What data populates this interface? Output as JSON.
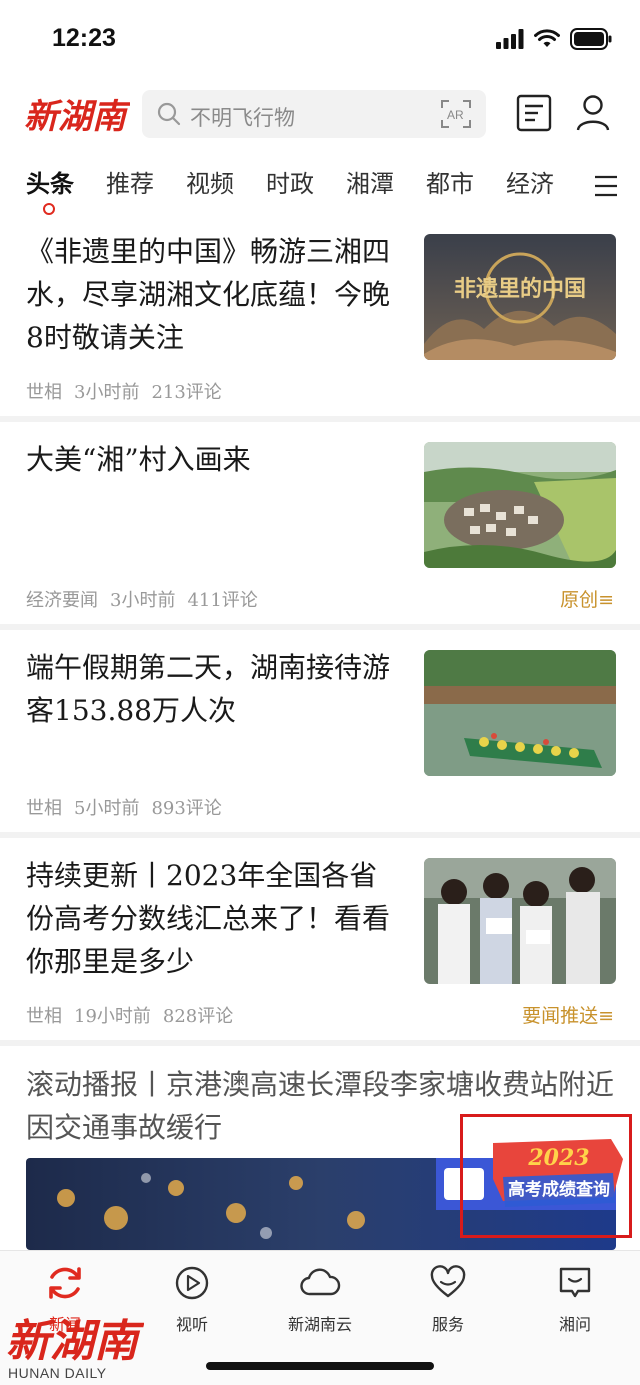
{
  "status_bar": {
    "time": "12:23"
  },
  "header": {
    "logo_text": "新湖南",
    "search_placeholder": "不明飞行物",
    "ar_label": "AR"
  },
  "tabs": [
    "头条",
    "推荐",
    "视频",
    "时政",
    "湘潭",
    "都市",
    "经济"
  ],
  "active_tab": "头条",
  "articles": [
    {
      "title": "《非遗里的中国》畅游三湘四水，尽享湖湘文化底蕴！今晚8时敬请关注",
      "source": "世相",
      "time": "3小时前",
      "comments": "213评论",
      "tag": "",
      "thumb_text": "非遗里的中国"
    },
    {
      "title": "大美“湘”村入画来",
      "source": "经济要闻",
      "time": "3小时前",
      "comments": "411评论",
      "tag": "原创≡"
    },
    {
      "title": "端午假期第二天，湖南接待游客153.88万人次",
      "source": "世相",
      "time": "5小时前",
      "comments": "893评论",
      "tag": ""
    },
    {
      "title": "持续更新丨2023年全国各省份高考分数线汇总来了！看看你那里是多少",
      "source": "世相",
      "time": "19小时前",
      "comments": "828评论",
      "tag": "要闻推送≡"
    }
  ],
  "rolling_news": {
    "title": "滚动播报丨京港澳高速长潭段李家塘收费站附近因交通事故缓行"
  },
  "floating_badge": {
    "year": "2023",
    "label": "高考成绩查询"
  },
  "tabbar": [
    {
      "label": "新闻",
      "icon": "refresh-icon",
      "active": true
    },
    {
      "label": "视听",
      "icon": "play-circle-icon",
      "active": false
    },
    {
      "label": "新湖南云",
      "icon": "cloud-icon",
      "active": false
    },
    {
      "label": "服务",
      "icon": "heart-icon",
      "active": false
    },
    {
      "label": "湘问",
      "icon": "chat-icon",
      "active": false
    }
  ],
  "watermark": {
    "logo_text": "新湖南",
    "sub_text": "HUNAN DAILY"
  },
  "colors": {
    "brand_red": "#e02a1f",
    "tag_gold": "#c8922c",
    "meta_gray": "#999999"
  }
}
